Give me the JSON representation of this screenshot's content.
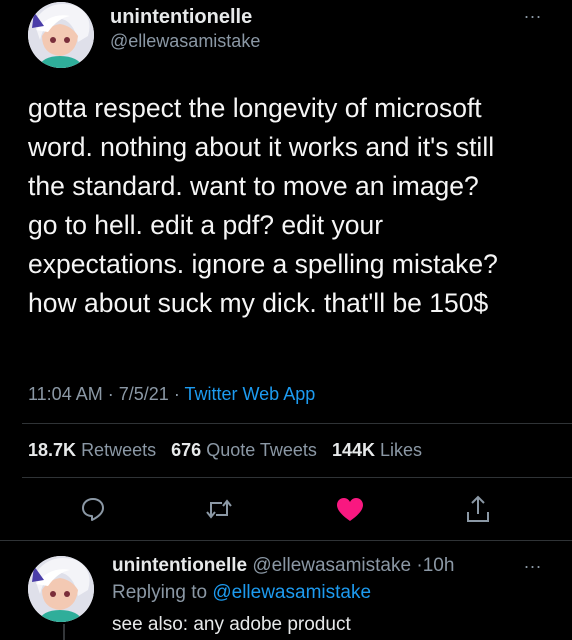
{
  "main_tweet": {
    "author_name": "unintentionelle",
    "author_handle": "@ellewasamistake",
    "more_label": "...",
    "text_lines": [
      "gotta respect the longevity of microsoft",
      "word. nothing about it works and it's still",
      "the standard. want to move an image?",
      "go to hell. edit a pdf? edit your",
      "expectations. ignore a spelling mistake?",
      "how about suck my dick. that'll be 150$"
    ],
    "time": "11:04 AM",
    "date": "7/5/21",
    "separator": "·",
    "source": "Twitter Web App",
    "stats": {
      "retweets_count": "18.7K",
      "retweets_label": "Retweets",
      "quotes_count": "676",
      "quotes_label": "Quote Tweets",
      "likes_count": "144K",
      "likes_label": "Likes"
    },
    "colors": {
      "like_active": "#f91880",
      "link": "#1d9bf0",
      "secondary_text": "#8b98a5"
    }
  },
  "reply": {
    "author_name": "unintentionelle",
    "author_handle": "@ellewasamistake",
    "separator": "·",
    "time": "10h",
    "more_label": "...",
    "replying_to_label": "Replying to",
    "replying_to_handle": "@ellewasamistake",
    "text": "see also: any adobe product"
  }
}
